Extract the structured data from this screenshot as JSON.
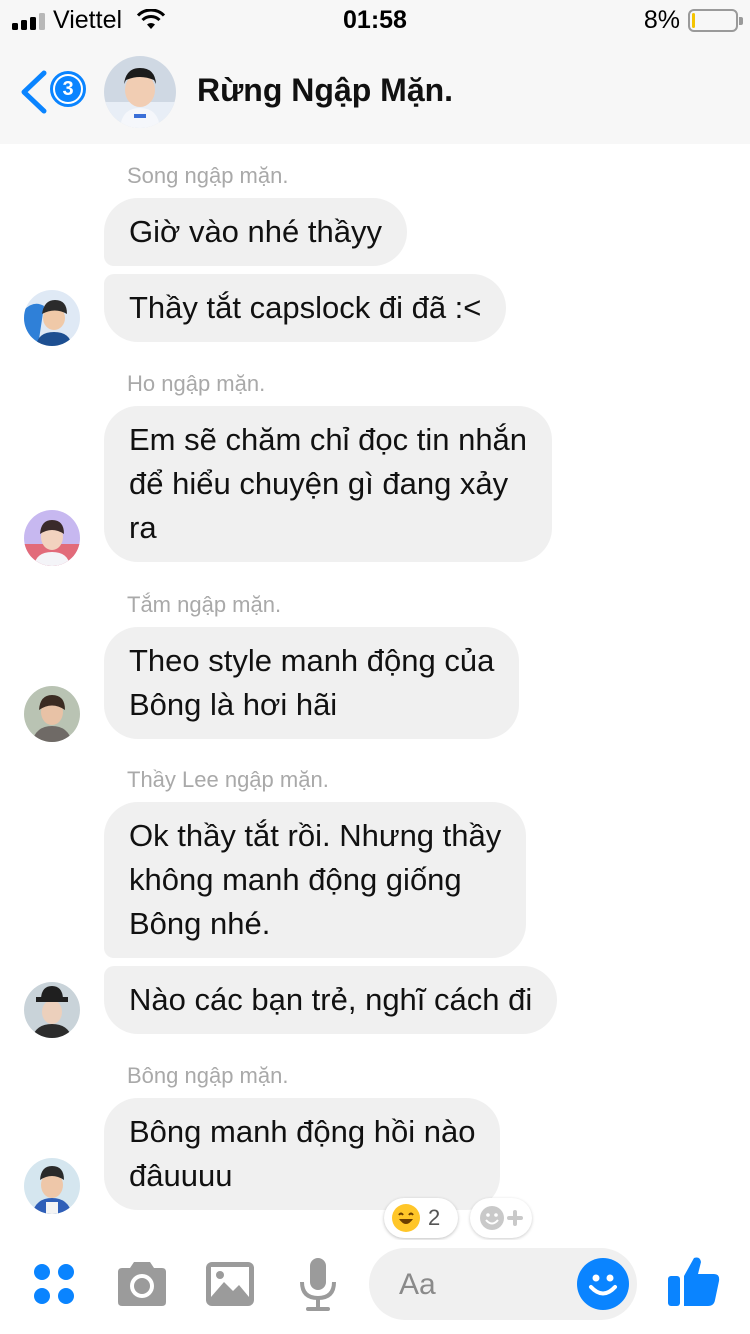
{
  "status_bar": {
    "carrier": "Viettel",
    "time": "01:58",
    "battery_percent_label": "8%",
    "battery_level": 0.08
  },
  "header": {
    "unread_count": "3",
    "title": "Rừng Ngập Mặn."
  },
  "messages": [
    {
      "sender": "Song ngập mặn.",
      "bubbles": [
        "Giờ vào nhé thầyy",
        "Thầy tắt capslock đi đã :<"
      ]
    },
    {
      "sender": "Ho ngập mặn.",
      "bubbles": [
        "Em sẽ chăm chỉ đọc tin nhắn\nđể hiểu chuyện gì đang xảy\nra"
      ]
    },
    {
      "sender": "Tắm ngập mặn.",
      "bubbles": [
        "Theo style manh động của\nBông là hơi hãi"
      ]
    },
    {
      "sender": "Thầy Lee ngập mặn.",
      "bubbles": [
        "Ok thầy tắt rồi. Nhưng thầy\nkhông manh động giống\nBông nhé.",
        "Nào các bạn trẻ, nghĩ cách đi"
      ]
    },
    {
      "sender": "Bông ngập mặn.",
      "bubbles": [
        "Bông manh động hồi nào\nđâuuuu"
      ]
    }
  ],
  "reaction": {
    "emoji": "laughing-emoji",
    "count": "2"
  },
  "composer": {
    "placeholder": "Aa",
    "icons": [
      "apps-icon",
      "camera-icon",
      "image-icon",
      "microphone-icon",
      "emoji-icon",
      "thumbs-up-icon"
    ]
  },
  "colors": {
    "accent": "#0a84ff",
    "bubble": "#f0f0f0",
    "sender_text": "#a9a9a9",
    "header_bg": "#f7f7f7",
    "tool_gray": "#9b9b9b"
  }
}
